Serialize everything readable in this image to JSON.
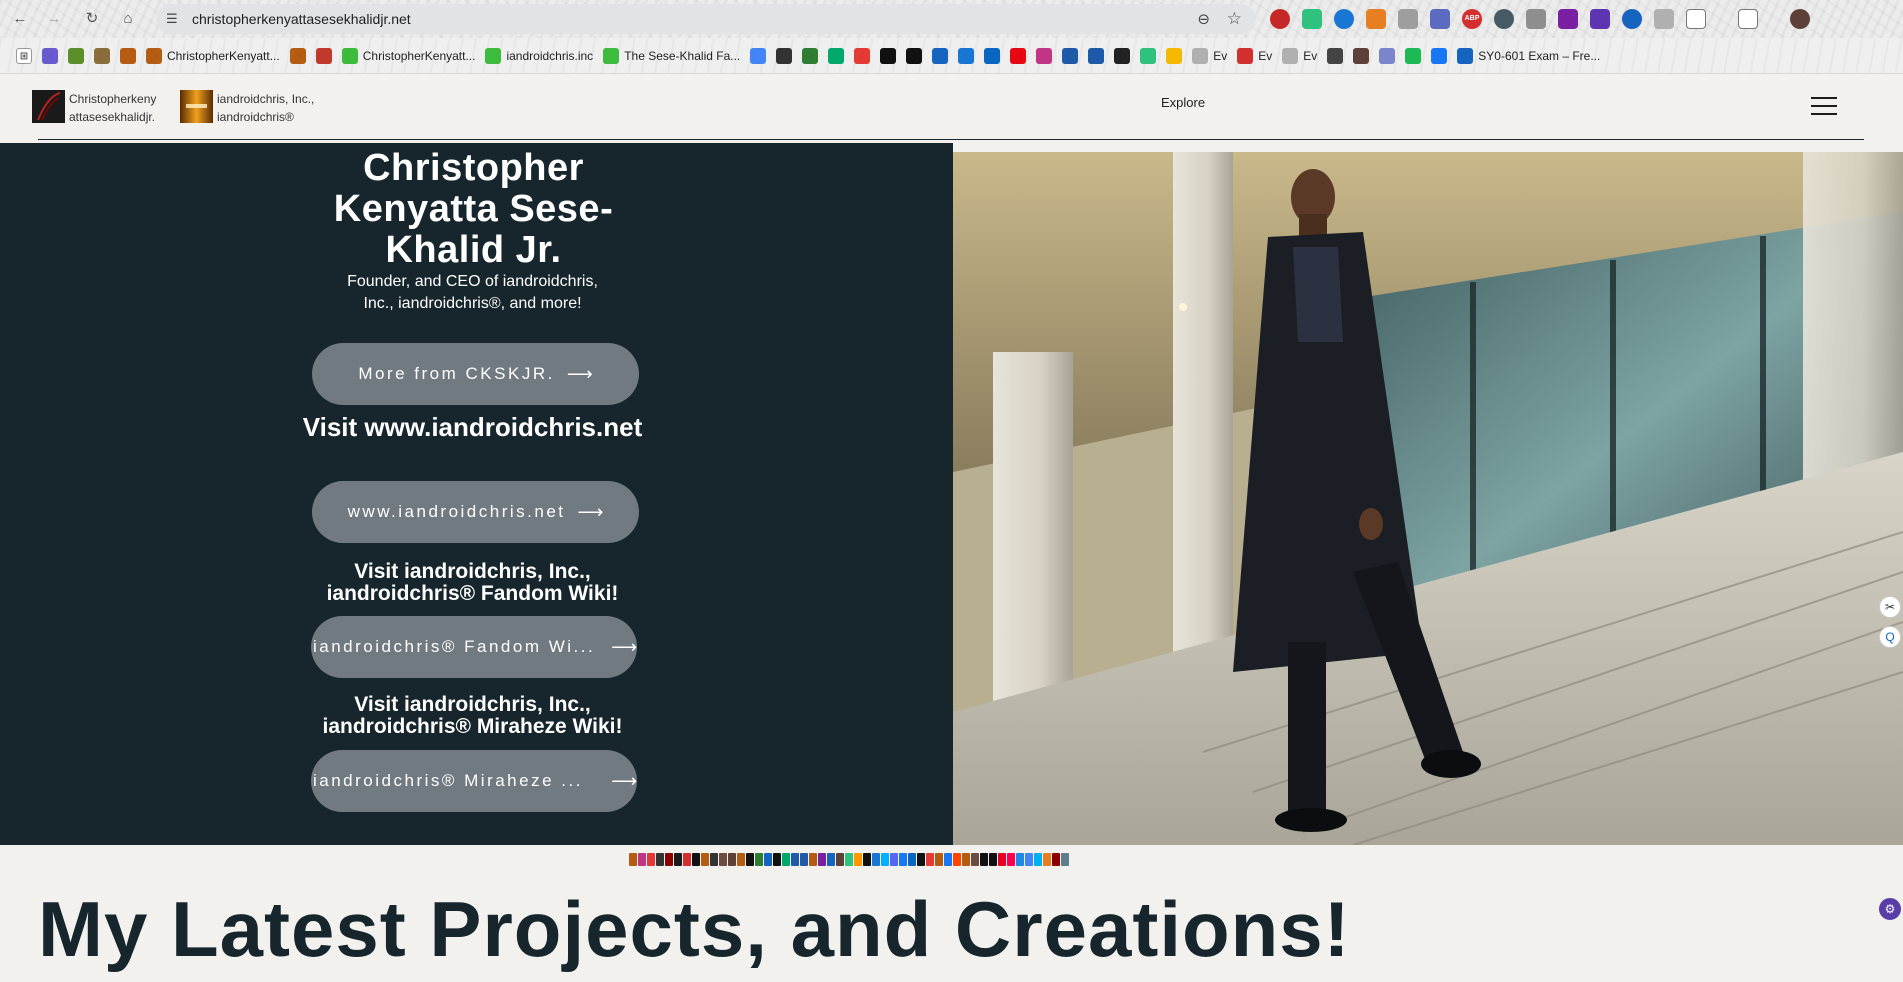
{
  "browser": {
    "url": "christopherkenyattasesekhalidjr.net",
    "bookmarks": [
      {
        "label": "",
        "color": "#6a5acd"
      },
      {
        "label": "",
        "color": "#5a8f29"
      },
      {
        "label": "",
        "color": "#8a6d3b"
      },
      {
        "label": "",
        "color": "#b35c12"
      },
      {
        "label": "ChristopherKenyatt...",
        "color": "#b35c12"
      },
      {
        "label": "",
        "color": "#b35c12"
      },
      {
        "label": "",
        "color": "#c0392b"
      },
      {
        "label": "ChristopherKenyatt...",
        "color": "#3dbb3d"
      },
      {
        "label": "iandroidchris.inc",
        "color": "#3dbb3d"
      },
      {
        "label": "The Sese-Khalid Fa...",
        "color": "#3dbb3d"
      },
      {
        "label": "",
        "color": "#4285f4"
      },
      {
        "label": "",
        "color": "#333333"
      },
      {
        "label": "",
        "color": "#2e7d32"
      },
      {
        "label": "",
        "color": "#00a86b"
      },
      {
        "label": "",
        "color": "#e53935"
      },
      {
        "label": "",
        "color": "#111111"
      },
      {
        "label": "",
        "color": "#111111"
      },
      {
        "label": "",
        "color": "#1565c0"
      },
      {
        "label": "",
        "color": "#1976d2"
      },
      {
        "label": "",
        "color": "#0a66c2"
      },
      {
        "label": "",
        "color": "#e50914"
      },
      {
        "label": "",
        "color": "#c13584"
      },
      {
        "label": "",
        "color": "#1e5aa8"
      },
      {
        "label": "",
        "color": "#1e5aa8"
      },
      {
        "label": "",
        "color": "#222222"
      },
      {
        "label": "",
        "color": "#2ec27e"
      },
      {
        "label": "",
        "color": "#f5b800"
      },
      {
        "label": "Ev",
        "color": "#b0b0b0"
      },
      {
        "label": "Ev",
        "color": "#d32f2f"
      },
      {
        "label": "Ev",
        "color": "#b0b0b0"
      },
      {
        "label": "",
        "color": "#444444"
      },
      {
        "label": "",
        "color": "#5d4037"
      },
      {
        "label": "",
        "color": "#7986cb"
      },
      {
        "label": "",
        "color": "#1db954"
      },
      {
        "label": "",
        "color": "#1877f2"
      },
      {
        "label": "SY0-601 Exam – Fre...",
        "color": "#1565c0"
      }
    ]
  },
  "header": {
    "brand1_text": "Christopherkeny attasesekhalidjr.",
    "brand2_text": "iandroidchris, Inc., iandroidchris®",
    "explore_label": "Explore"
  },
  "hero": {
    "title": "Christopher Kenyatta Sese-Khalid Jr.",
    "subtitle": "Founder, and CEO of iandroidchris, Inc., iandroidchris®, and more!",
    "btn_more": "More from CKSKJR.",
    "visit_site_heading": "Visit www.iandroidchris.net",
    "btn_site": "www.iandroidchris.net",
    "fandom_heading": "Visit iandroidchris, Inc., iandroidchris® Fandom Wiki!",
    "btn_fandom": "iandroidchris® Fandom Wi...",
    "miraheze_heading": "Visit iandroidchris, Inc., iandroidchris® Miraheze Wiki!",
    "btn_miraheze": "iandroidchris® Miraheze ...",
    "arrow": "⟶"
  },
  "projects": {
    "title": "My Latest Projects, and Creations!"
  },
  "colors": {
    "hero_bg": "#16262c",
    "button_bg": "#707a80",
    "page_bg": "#f2f1ee"
  }
}
